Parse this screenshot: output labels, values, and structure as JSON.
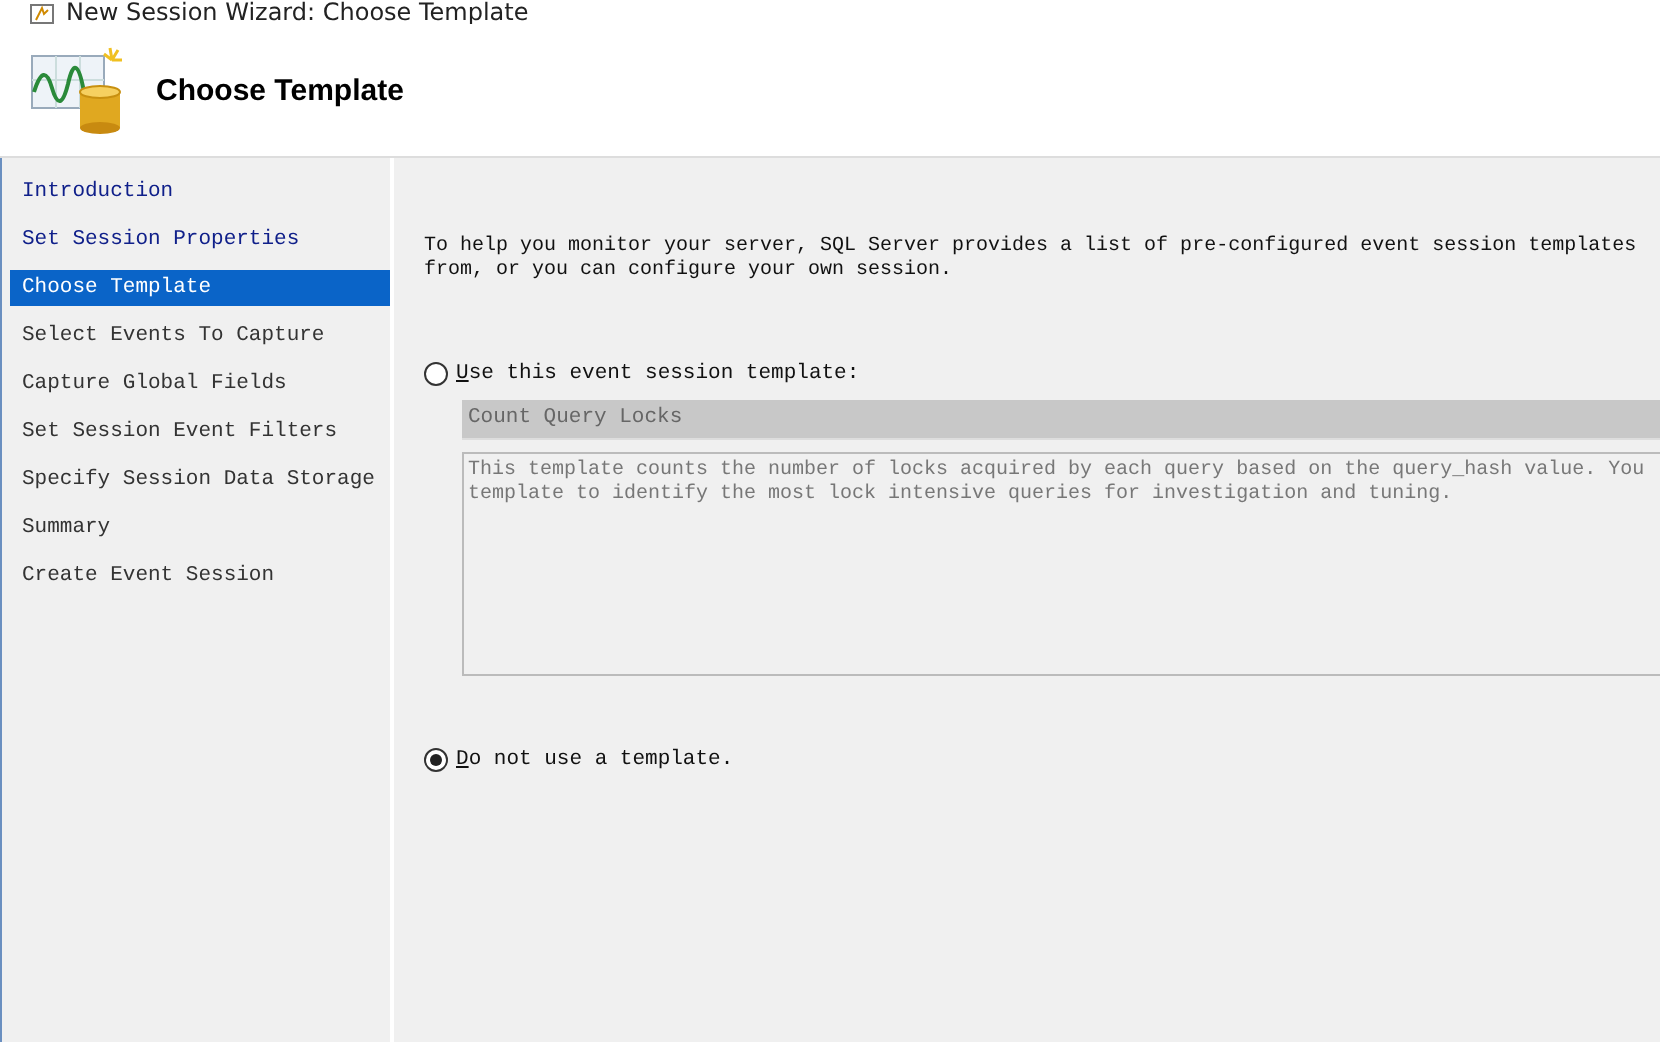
{
  "window": {
    "title": "New Session Wizard: Choose Template"
  },
  "header": {
    "title": "Choose Template"
  },
  "sidebar": {
    "items": [
      {
        "label": "Introduction",
        "selected": false,
        "completed": true
      },
      {
        "label": "Set Session Properties",
        "selected": false,
        "completed": true
      },
      {
        "label": "Choose Template",
        "selected": true,
        "completed": false
      },
      {
        "label": "Select Events To Capture",
        "selected": false,
        "completed": false
      },
      {
        "label": "Capture Global Fields",
        "selected": false,
        "completed": false
      },
      {
        "label": "Set Session Event Filters",
        "selected": false,
        "completed": false
      },
      {
        "label": "Specify Session Data Storage",
        "selected": false,
        "completed": false
      },
      {
        "label": "Summary",
        "selected": false,
        "completed": false
      },
      {
        "label": "Create Event Session",
        "selected": false,
        "completed": false
      }
    ]
  },
  "intro": "To help you monitor your server, SQL Server provides a list of pre-configured event session templates\nfrom, or you can configure your own session.",
  "options": [
    {
      "label": "Use this event session template:",
      "selected": false
    },
    {
      "label": "Do not use a template.",
      "selected": true
    }
  ],
  "template": {
    "value": "Count Query Locks",
    "disabled": true,
    "description": "This template counts the number of locks acquired by each query based on the query_hash value. You\ntemplate to identify the most lock intensive queries for investigation and tuning."
  }
}
